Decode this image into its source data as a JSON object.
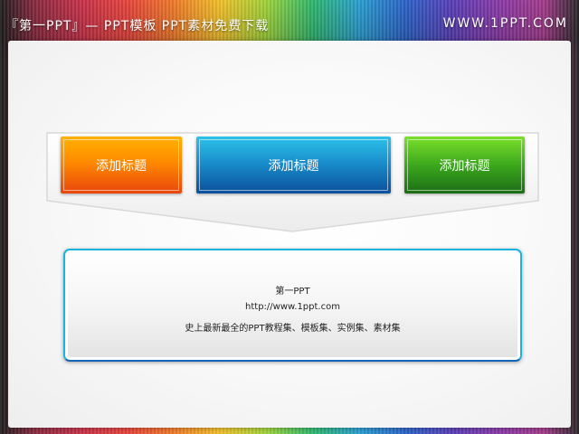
{
  "header": {
    "left_title": "『第一PPT』— PPT模板 PPT素材免费下载",
    "right_url": "WWW.1PPT.COM"
  },
  "boxes": [
    {
      "label": "添加标题",
      "color": "#ff8a00"
    },
    {
      "label": "添加标题",
      "color": "#1a8fcd"
    },
    {
      "label": "添加标题",
      "color": "#3ca81d"
    }
  ],
  "panel": {
    "line1": "第一PPT",
    "line2": "http://www.1ppt.com",
    "line3": "史上最新最全的PPT教程集、模板集、实例集、素材集",
    "border_color": "#19b3e0"
  }
}
